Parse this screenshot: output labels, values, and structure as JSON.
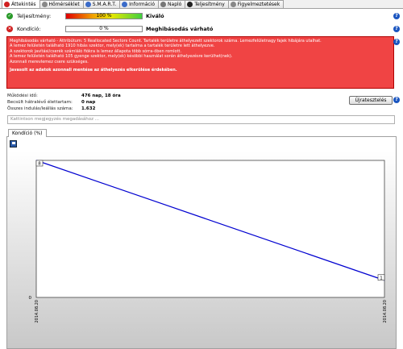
{
  "tabs": [
    {
      "label": "Áttekintés",
      "icon": "error-icon",
      "color": "#d02020"
    },
    {
      "label": "Hőmérséklet",
      "icon": "thermometer-icon",
      "color": "#888"
    },
    {
      "label": "S.M.A.R.T.",
      "icon": "smart-icon",
      "color": "#3a6bc9"
    },
    {
      "label": "Információ",
      "icon": "info-icon",
      "color": "#3a6bc9"
    },
    {
      "label": "Napló",
      "icon": "log-icon",
      "color": "#777"
    },
    {
      "label": "Teljesítmény",
      "icon": "performance-icon",
      "color": "#222"
    },
    {
      "label": "Figyelmeztetések",
      "icon": "alerts-icon",
      "color": "#888"
    }
  ],
  "health": {
    "label": "Teljesítmény:",
    "bar_text": "100 %",
    "value_pct": 100,
    "status": "Kiváló"
  },
  "condition": {
    "label": "Kondíció:",
    "bar_text": "0 %",
    "value_pct": 0,
    "status": "Meghibásodás várható"
  },
  "alert": {
    "lines": [
      "Meghibásodás várható - Attribútum: 5 Reallocated Sectors Count. Tartalék területre áthelyezett szektorok száma. Lemezfelületnagy fajek hibájára utalhat.",
      "A lemez felületén található 1910 hibás szektor, mely(ek) tartalma a tartalék területre lett áthelyezve.",
      "A szektorok javítási/cserék számláló fiókra is lemez állapota több sórra-öben romlott.",
      "A lemez felületén található 105 gyenge szektor, mely(ek) késöbbi használat során áthelyezésre kerülhet(nek).",
      "Azonnali merevlemez csere szükséges."
    ],
    "recommendation": "Javasolt az adatok azonnali mentése az áthelyezés elkerülése érdekében."
  },
  "stats": [
    {
      "key": "Működési idő:",
      "value": "476 nap, 18 óra"
    },
    {
      "key": "Becsült hátralévő élettartam:",
      "value": "0 nap"
    },
    {
      "key": "Összes indulás/leállás száma:",
      "value": "1.632"
    }
  ],
  "retest_label": "Újratesztelés",
  "comment_placeholder": "Kattintson megjegyzés megadásához ...",
  "chart_tab_label": "Kondíció  (%)",
  "chart_data": {
    "type": "line",
    "x": [
      "2014.08.20",
      "2014.08.20"
    ],
    "series": [
      {
        "values": [
          8,
          1
        ]
      }
    ],
    "point_labels": [
      "8",
      "1"
    ],
    "ytick_labels": [
      "0"
    ],
    "ylim": [
      0,
      8
    ],
    "grid": false,
    "line_color": "#0000d0"
  }
}
